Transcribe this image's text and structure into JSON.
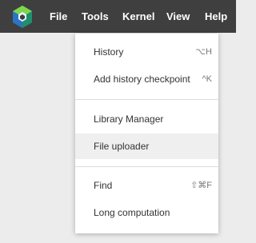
{
  "menubar": {
    "logo_icon": "colab-hexagon-logo",
    "items": [
      {
        "label": "File"
      },
      {
        "label": "Tools"
      },
      {
        "label": "Kernel"
      },
      {
        "label": "View"
      },
      {
        "label": "Help"
      }
    ],
    "open_menu": "Tools"
  },
  "dropdown": {
    "items": [
      {
        "label": "History",
        "shortcut": "⌥H"
      },
      {
        "label": "Add history checkpoint",
        "shortcut": "^K"
      },
      {
        "label": "Library Manager",
        "shortcut": ""
      },
      {
        "label": "File uploader",
        "shortcut": "",
        "highlighted": true
      },
      {
        "label": "Find",
        "shortcut": "⇧⌘F"
      },
      {
        "label": "Long computation",
        "shortcut": ""
      }
    ]
  },
  "colors": {
    "menubar_bg": "#3f3f3f",
    "menu_text": "#ffffff",
    "dropdown_bg": "#ffffff",
    "highlight_bg": "#efefef",
    "logo_green": "#2fb56a",
    "logo_blue": "#2b74c4"
  }
}
